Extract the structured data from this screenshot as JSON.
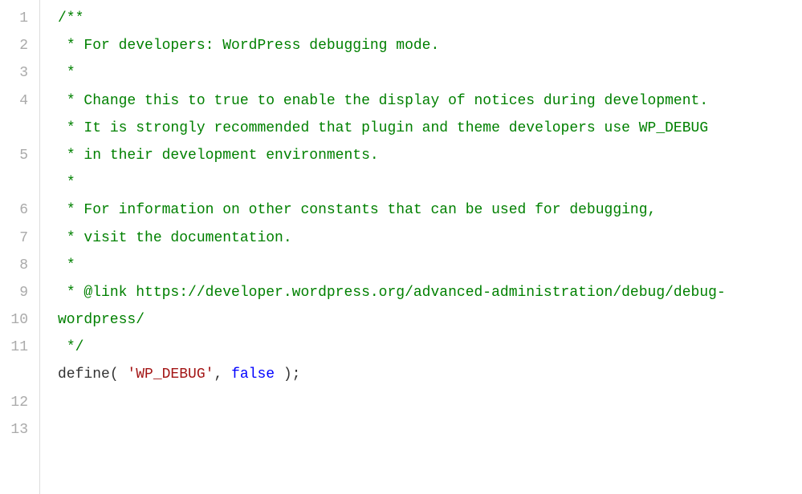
{
  "lineNumbers": [
    "1",
    "2",
    "3",
    "4",
    "5",
    "6",
    "7",
    "8",
    "9",
    "10",
    "11",
    "12",
    "13"
  ],
  "wrappedLines": [
    4,
    5,
    11
  ],
  "code": {
    "l1": "/**",
    "l2": " * For developers: WordPress debugging mode.",
    "l3": " *",
    "l4": " * Change this to true to enable the display of notices during development.",
    "l5": " * It is strongly recommended that plugin and theme developers use WP_DEBUG",
    "l6": " * in their development environments.",
    "l7": " *",
    "l8": " * For information on other constants that can be used for debugging,",
    "l9": " * visit the documentation.",
    "l10": " *",
    "l11": " * @link https://developer.wordpress.org/advanced-administration/debug/debug-wordpress/",
    "l12": " */",
    "l13_func": "define",
    "l13_open": "( ",
    "l13_str": "'WP_DEBUG'",
    "l13_comma": ", ",
    "l13_val": "false",
    "l13_close": " );"
  }
}
